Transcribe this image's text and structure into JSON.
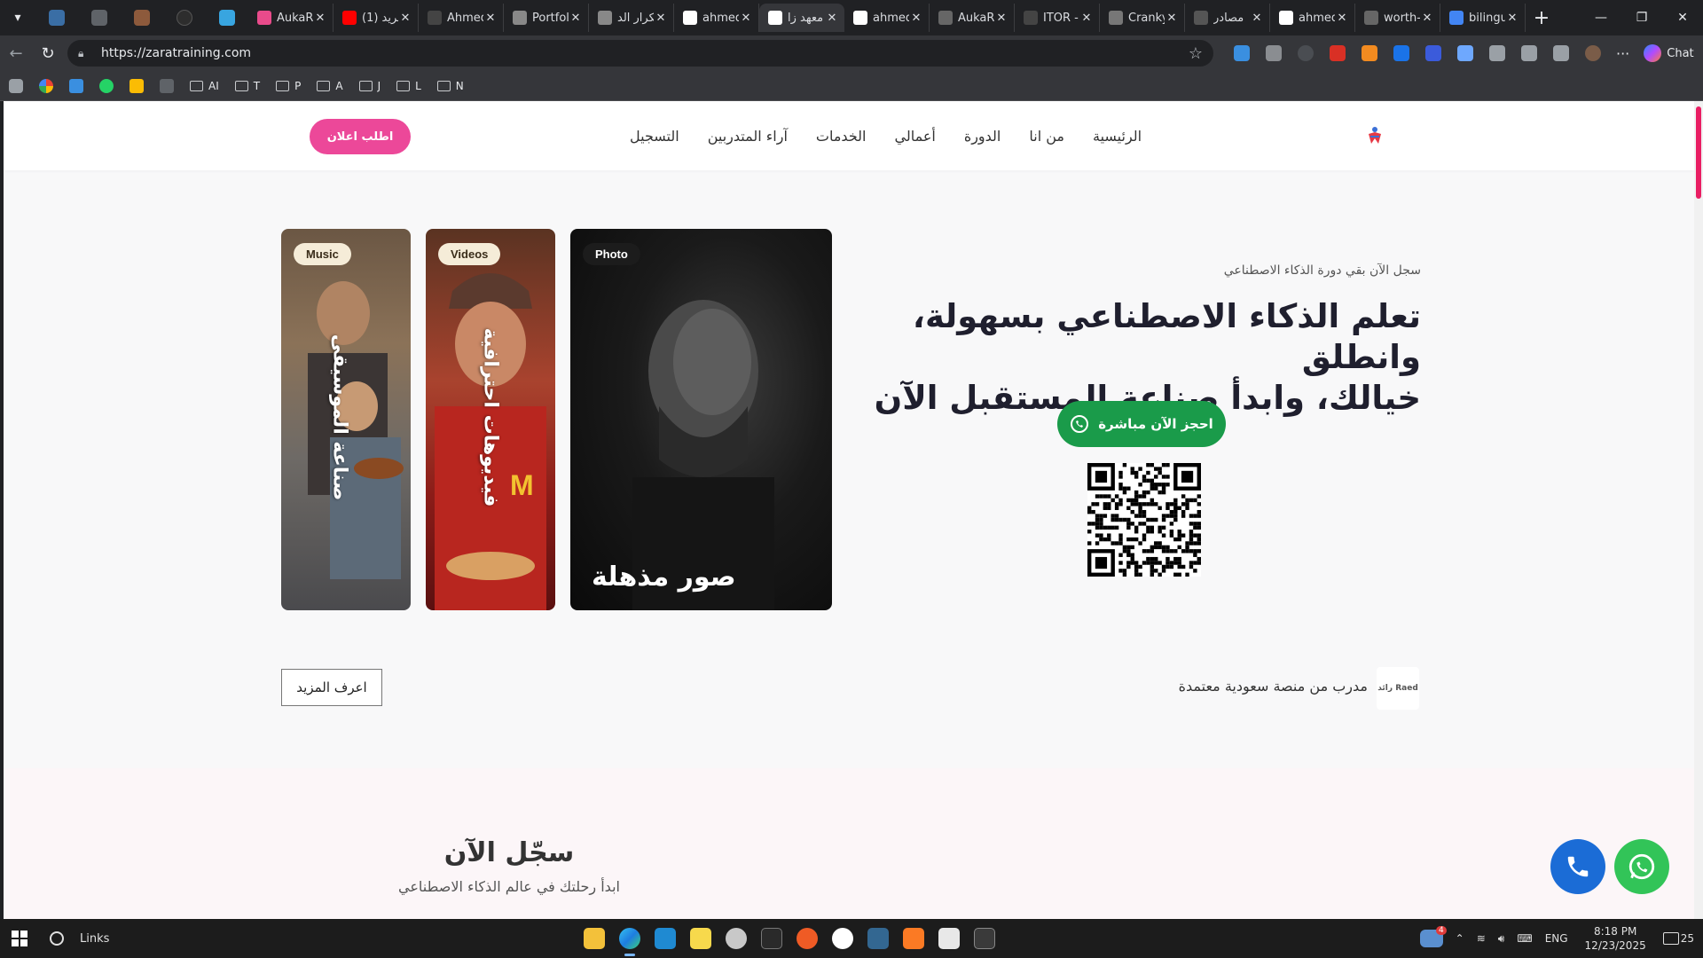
{
  "browser": {
    "url": "https://zaratraining.com",
    "chat_label": "Chat",
    "tabs": [
      {
        "title": "AukaRo",
        "favicon_color": "#e94b8b"
      },
      {
        "title": "(1) فريد",
        "favicon_color": "#ff0000"
      },
      {
        "title": "Ahmed",
        "favicon_color": "#444444"
      },
      {
        "title": "Portfolio",
        "favicon_color": "#888888"
      },
      {
        "title": "تكرار الد",
        "favicon_color": "#888888"
      },
      {
        "title": "ahmed",
        "favicon_color": "#ffffff"
      },
      {
        "title": "معهد زا",
        "favicon_color": "#ffffff"
      },
      {
        "title": "ahmed",
        "favicon_color": "#ffffff"
      },
      {
        "title": "AukaRo",
        "favicon_color": "#666666"
      },
      {
        "title": "ITOR -",
        "favicon_color": "#444444"
      },
      {
        "title": "Cranky",
        "favicon_color": "#777777"
      },
      {
        "title": "مصادر",
        "favicon_color": "#555555"
      },
      {
        "title": "ahmed",
        "favicon_color": "#ffffff"
      },
      {
        "title": "worth-",
        "favicon_color": "#666666"
      },
      {
        "title": "bilingu",
        "favicon_color": "#4285f4"
      }
    ],
    "active_tab_index": 6,
    "bookmarks": [
      "AI",
      "T",
      "P",
      "A",
      "J",
      "L",
      "N"
    ]
  },
  "site": {
    "nav": [
      "الرئيسية",
      "من انا",
      "الدورة",
      "أعمالي",
      "الخدمات",
      "آراء المتدربين",
      "التسجيل"
    ],
    "ad_button": "اطلب اعلان",
    "cards": [
      {
        "badge": "Music",
        "vertical_text": "صناعة الموسيقى"
      },
      {
        "badge": "Videos",
        "vertical_text": "فيديوهات احترافية"
      },
      {
        "badge": "Photo",
        "caption": "صور مذهلة"
      }
    ],
    "hero_sub": "سجل الآن بقي دورة الذكاء الاصطناعي",
    "hero_title_line1": "تعلم الذكاء الاصطناعي بسهولة، وانطلق",
    "hero_title_line2": "خيالك، وابدأ صناعة المستقبل الآن",
    "book_button": "احجز الآن مباشرة",
    "raed_logo": "رائد Raed",
    "raed_text": "مدرب من منصة سعودية معتمدة",
    "more_button": "اعرف المزيد",
    "register_title": "سجّل الآن",
    "register_sub": "ابدأ رحلتك في عالم الذكاء الاصطناعي"
  },
  "taskbar": {
    "search_label": "Links",
    "lang": "ENG",
    "time": "8:18 PM",
    "date": "12/23/2025",
    "notifications": "25",
    "badge_count": "4"
  },
  "colors": {
    "accent_pink": "#ec4899",
    "whatsapp_green": "#1a9b4a",
    "phone_blue": "#1b6cd6"
  }
}
